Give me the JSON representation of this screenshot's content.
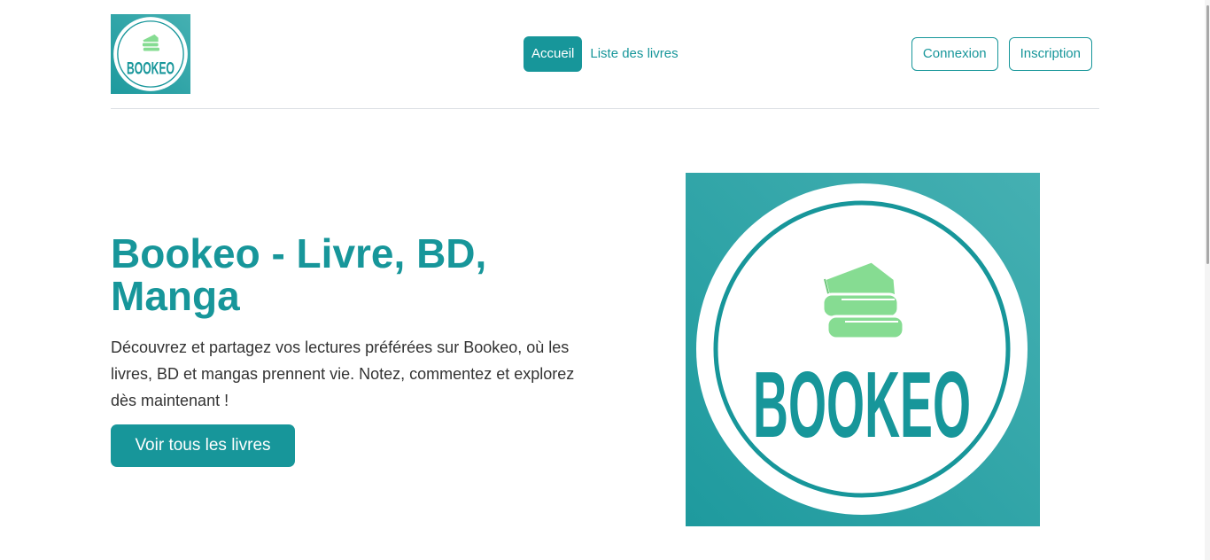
{
  "brand": {
    "logo_text": "BOOKEO"
  },
  "nav": {
    "items": [
      {
        "label": "Accueil",
        "active": true
      },
      {
        "label": "Liste des livres",
        "active": false
      }
    ]
  },
  "auth": {
    "login_label": "Connexion",
    "register_label": "Inscription"
  },
  "hero": {
    "title": "Bookeo - Livre, BD, Manga",
    "description": "Découvrez et partagez vos lectures préférées sur Bookeo, où les livres, BD et mangas prennent vie. Notez, commentez et explorez dès maintenant !",
    "cta_label": "Voir tous les livres"
  },
  "colors": {
    "accent": "#17969a",
    "logo_bg": "#2aa6a8",
    "books_icon": "#86dc92"
  }
}
